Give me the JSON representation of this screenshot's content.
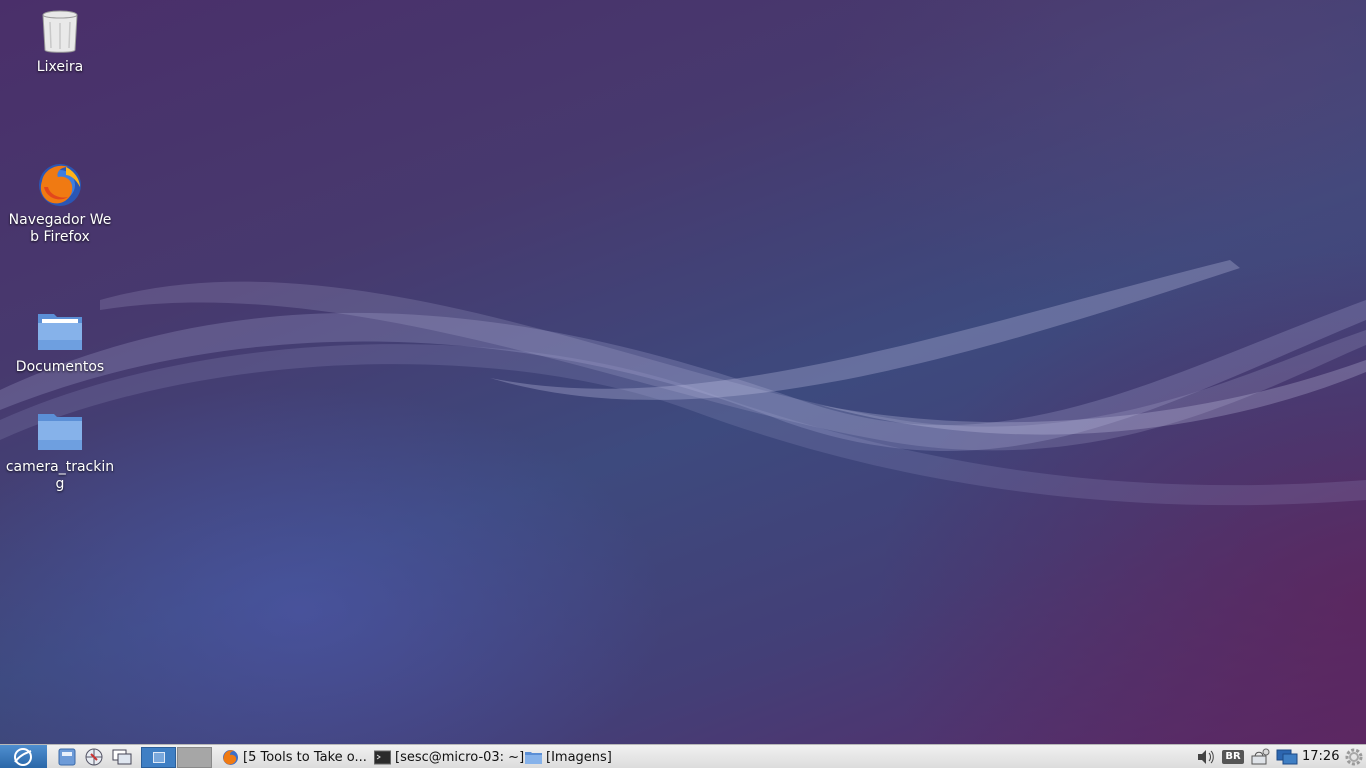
{
  "desktop": {
    "icons": [
      {
        "label": "Lixeira",
        "icon": "trash-icon"
      },
      {
        "label": "Navegador Web Firefox",
        "icon": "firefox-icon"
      },
      {
        "label": "Documentos",
        "icon": "folder-icon"
      },
      {
        "label": "camera_tracking",
        "icon": "folder-icon"
      }
    ]
  },
  "taskbar": {
    "tasks": [
      {
        "label": "[5 Tools to Take o...",
        "icon": "firefox-icon"
      },
      {
        "label": "[sesc@micro-03: ~]",
        "icon": "terminal-icon"
      },
      {
        "label": "[Imagens]",
        "icon": "folder-icon"
      }
    ],
    "keyboard_layout": "BR",
    "clock": "17:26"
  },
  "colors": {
    "taskbar_bg": "#e6e6e6",
    "menu_button": "#3a7bc0",
    "active_workspace": "#3f7fc4"
  }
}
